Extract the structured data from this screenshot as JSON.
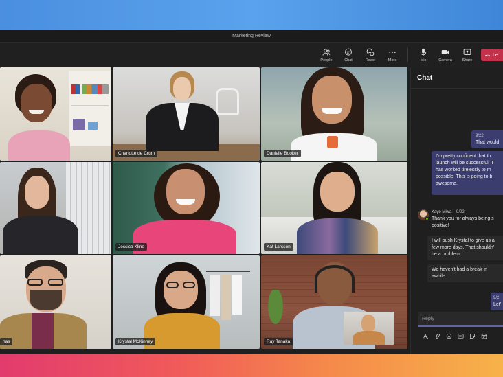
{
  "window": {
    "title": "Marketing Review"
  },
  "toolbar": {
    "people_label": "People",
    "chat_label": "Chat",
    "react_label": "React",
    "more_label": "More",
    "mic_label": "Mic",
    "camera_label": "Camera",
    "share_label": "Share",
    "leave_label": "Le"
  },
  "participants": [
    {
      "name": ""
    },
    {
      "name": "Charlotte de Crum"
    },
    {
      "name": "Danielle Booker"
    },
    {
      "name": ""
    },
    {
      "name": "Jessica Kline"
    },
    {
      "name": "Kat Larsson"
    },
    {
      "name": "has"
    },
    {
      "name": "Krystal McKinney"
    },
    {
      "name": "Ray Tanaka"
    }
  ],
  "chat": {
    "title": "Chat",
    "messages": [
      {
        "from": "me",
        "time": "9/22",
        "text_lines": [
          "That would"
        ]
      },
      {
        "from": "me",
        "time": "",
        "text_lines": [
          "I'm pretty confident that th",
          "launch will be successful. T",
          "has worked tirelessly to m",
          "possible. This is going to b",
          "awesome."
        ]
      },
      {
        "from": "other",
        "author": "Kayo Miwa",
        "time": "9/22",
        "text_lines": [
          "Thank you for always being s",
          "positive!"
        ]
      },
      {
        "from": "other",
        "author": "",
        "time": "",
        "text_lines": [
          "I will push Krystal to give us a",
          "few more days. That shouldn'",
          "be a problem."
        ]
      },
      {
        "from": "other",
        "author": "",
        "time": "",
        "text_lines": [
          "We haven't had a break in",
          "awhile."
        ]
      },
      {
        "from": "me",
        "time": "9/2",
        "text_lines": [
          "Let'"
        ]
      }
    ],
    "reply_placeholder": "Reply"
  },
  "colors": {
    "accent": "#6264a7",
    "leave": "#c4314b",
    "presence_available": "#6bb700",
    "my_bubble": "#3b3d6e"
  },
  "icons": [
    "people-icon",
    "chat-icon",
    "react-icon",
    "more-icon",
    "mic-icon",
    "camera-icon",
    "share-icon",
    "phone-hangup-icon",
    "format-icon",
    "attach-icon",
    "emoji-icon",
    "gif-icon",
    "sticker-icon",
    "schedule-icon"
  ]
}
